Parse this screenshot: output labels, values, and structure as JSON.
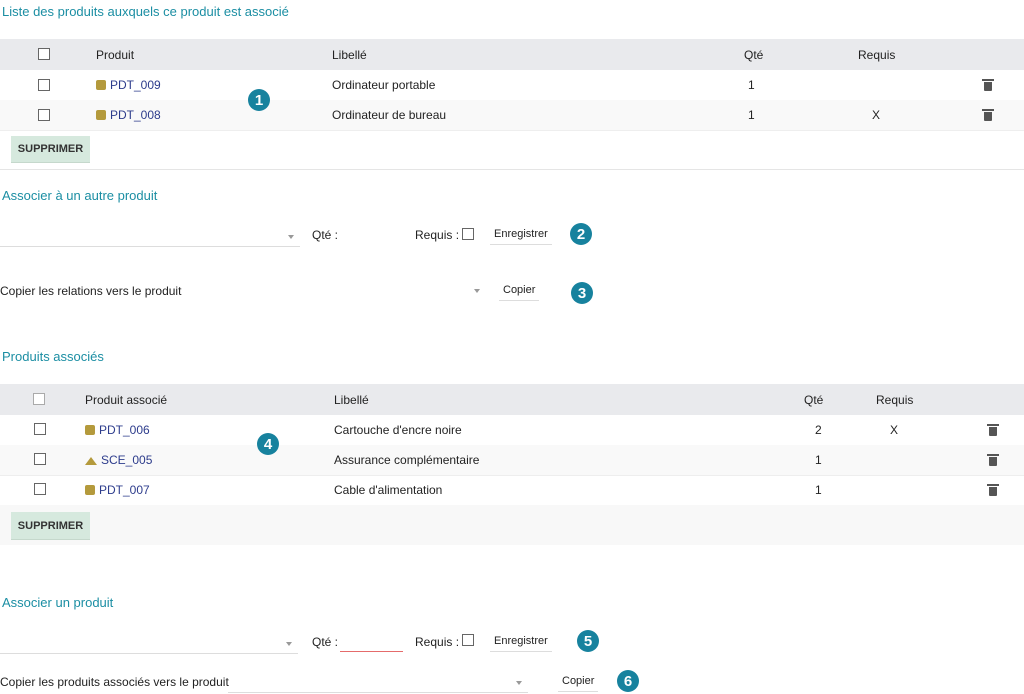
{
  "section1": {
    "title": "Liste des produits auxquels ce produit est associé",
    "headers": {
      "product": "Produit",
      "label": "Libellé",
      "qty": "Qté",
      "required": "Requis"
    },
    "rows": [
      {
        "code": "PDT_009",
        "label": "Ordinateur portable",
        "qty": "1",
        "required": "",
        "icon": "box-icon"
      },
      {
        "code": "PDT_008",
        "label": "Ordinateur de bureau",
        "qty": "1",
        "required": "X",
        "icon": "box-icon"
      }
    ],
    "delete_label": "SUPPRIMER",
    "badge": "1"
  },
  "associate_other": {
    "title": "Associer à un autre produit",
    "qty_label": "Qté :",
    "required_label": "Requis :",
    "save_label": "Enregistrer",
    "badge": "2"
  },
  "copy_relations": {
    "label": "Copier les relations vers le produit",
    "button": "Copier",
    "badge": "3"
  },
  "section2": {
    "title": "Produits associés",
    "headers": {
      "product": "Produit associé",
      "label": "Libellé",
      "qty": "Qté",
      "required": "Requis"
    },
    "rows": [
      {
        "code": "PDT_006",
        "label": "Cartouche d'encre noire",
        "qty": "2",
        "required": "X",
        "icon": "box-icon"
      },
      {
        "code": "SCE_005",
        "label": "Assurance complémentaire",
        "qty": "1",
        "required": "",
        "icon": "service-icon"
      },
      {
        "code": "PDT_007",
        "label": "Cable d'alimentation",
        "qty": "1",
        "required": "",
        "icon": "box-icon"
      }
    ],
    "delete_label": "SUPPRIMER",
    "badge": "4"
  },
  "associate_product": {
    "title": "Associer un produit",
    "qty_label": "Qté :",
    "required_label": "Requis :",
    "save_label": "Enregistrer",
    "badge": "5"
  },
  "copy_associated": {
    "label": "Copier les produits associés vers le produit",
    "button": "Copier",
    "badge": "6"
  }
}
